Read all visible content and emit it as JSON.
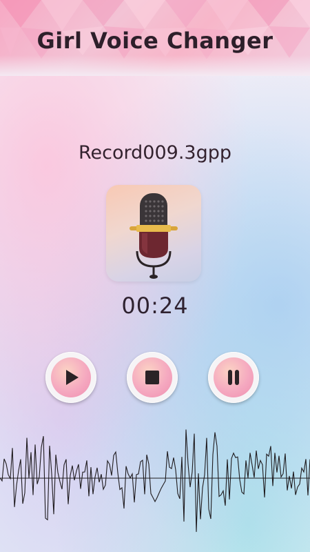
{
  "header": {
    "title": "Girl Voice Changer"
  },
  "player": {
    "file_name": "Record009.3gpp",
    "elapsed": "00:24"
  },
  "controls": {
    "play_icon": "play-icon",
    "stop_icon": "stop-icon",
    "pause_icon": "pause-icon"
  },
  "colors": {
    "accent_pink": "#f5a9c0",
    "text_dark": "#2d1f2a"
  }
}
